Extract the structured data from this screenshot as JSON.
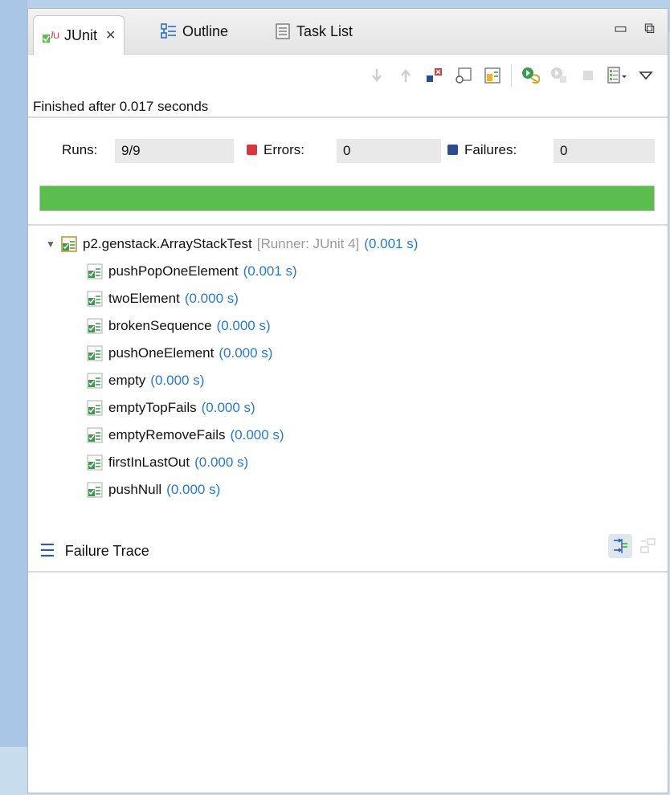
{
  "tabs": [
    {
      "label": "JUnit",
      "icon": "junit-icon",
      "close": "✕"
    },
    {
      "label": "Outline",
      "icon": "outline-icon"
    },
    {
      "label": "Task List",
      "icon": "task-list-icon"
    }
  ],
  "window_controls": {
    "minimize": "▭",
    "maximize": "⧉"
  },
  "toolbar": [
    {
      "icon": "next-failure-icon",
      "dim": true
    },
    {
      "icon": "previous-failure-icon",
      "dim": true
    },
    {
      "icon": "show-failures-only-icon"
    },
    {
      "icon": "scroll-lock-icon"
    },
    {
      "icon": "show-skipped-icon"
    },
    {
      "icon": "rerun-test-icon"
    },
    {
      "icon": "rerun-failed-first-icon",
      "dim": true
    },
    {
      "icon": "stop-icon",
      "dim": true
    },
    {
      "icon": "test-run-history-icon"
    },
    {
      "icon": "view-menu-icon"
    }
  ],
  "status_text": "Finished after 0.017 seconds",
  "counters": {
    "runs_label": "Runs:",
    "runs_value": "9/9",
    "errors_label": "Errors:",
    "errors_value": "0",
    "failures_label": "Failures:",
    "failures_value": "0"
  },
  "progress": {
    "fraction": 1.0,
    "color": "#5cbd4f"
  },
  "tree": {
    "suite": {
      "name": "p2.genstack.ArrayStackTest",
      "runner": "[Runner: JUnit 4]",
      "time": "(0.001 s)"
    },
    "tests": [
      {
        "name": "pushPopOneElement",
        "time": "(0.001 s)"
      },
      {
        "name": "twoElement",
        "time": "(0.000 s)"
      },
      {
        "name": "brokenSequence",
        "time": "(0.000 s)"
      },
      {
        "name": "pushOneElement",
        "time": "(0.000 s)"
      },
      {
        "name": "empty",
        "time": "(0.000 s)"
      },
      {
        "name": "emptyTopFails",
        "time": "(0.000 s)"
      },
      {
        "name": "emptyRemoveFails",
        "time": "(0.000 s)"
      },
      {
        "name": "firstInLastOut",
        "time": "(0.000 s)"
      },
      {
        "name": "pushNull",
        "time": "(0.000 s)"
      }
    ]
  },
  "failure_trace": {
    "label": "Failure Trace",
    "icon": "menu-icon"
  },
  "colors": {
    "pass_green": "#5cbd4f",
    "time_blue": "#2b79c2",
    "error_red": "#d9363e",
    "failure_blue": "#2a4d8f"
  }
}
